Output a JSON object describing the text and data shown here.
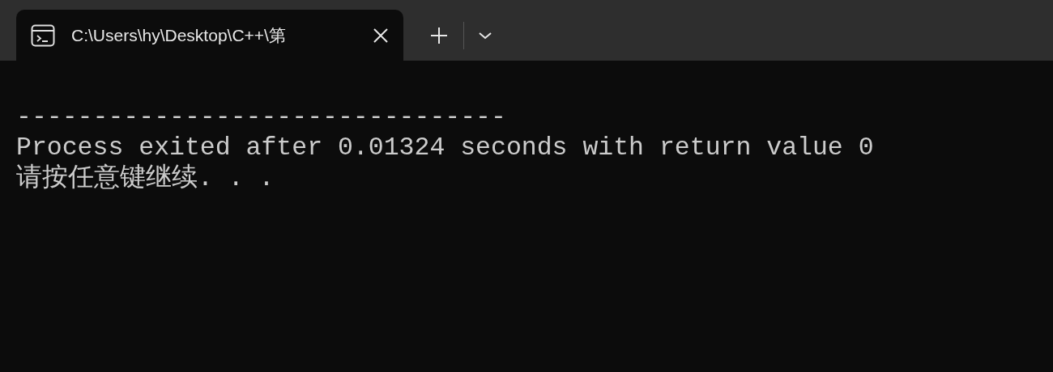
{
  "tab": {
    "title": "C:\\Users\\hy\\Desktop\\C++\\第",
    "selected": true
  },
  "console_lines": [
    "--------------------------------",
    "Process exited after 0.01324 seconds with return value 0",
    "请按任意键继续. . ."
  ]
}
